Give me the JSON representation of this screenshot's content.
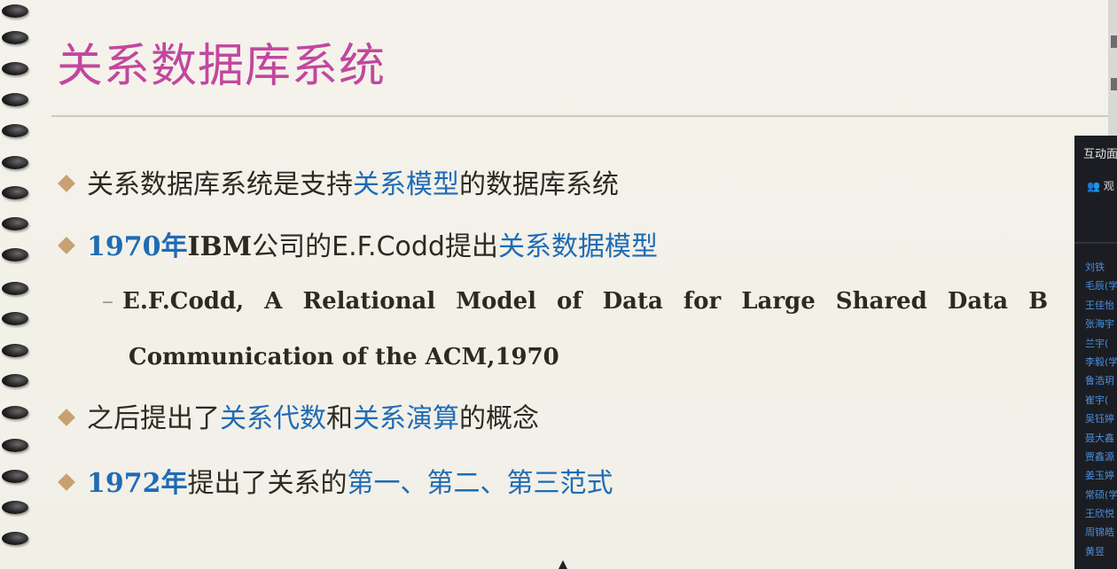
{
  "slide": {
    "title": "关系数据库系统",
    "bullets": [
      {
        "parts": [
          {
            "text": "关系数据库系统是支持",
            "style": "plain"
          },
          {
            "text": "关系模型",
            "style": "blue"
          },
          {
            "text": "的数据库系统",
            "style": "plain"
          }
        ]
      },
      {
        "parts": [
          {
            "text": "1970年",
            "style": "blue"
          },
          {
            "text": "IBM",
            "style": "plain"
          },
          {
            "text": "公司的E.F.Codd提出",
            "style": "plain"
          },
          {
            "text": "关系数据模型",
            "style": "blue"
          }
        ]
      },
      {
        "parts": [
          {
            "text": "之后提出了",
            "style": "plain"
          },
          {
            "text": "关系代数",
            "style": "blue"
          },
          {
            "text": "和",
            "style": "plain"
          },
          {
            "text": "关系演算",
            "style": "blue"
          },
          {
            "text": "的概念",
            "style": "plain"
          }
        ]
      },
      {
        "parts": [
          {
            "text": "1972年",
            "style": "blue"
          },
          {
            "text": "提出了关系的",
            "style": "plain"
          },
          {
            "text": "第一、第二、第三范式",
            "style": "blue"
          }
        ]
      }
    ],
    "sub_bullet": {
      "dash": "–",
      "line1": "E.F.Codd, A Relational Model of Data for Large Shared Data B",
      "line2": "Communication of the ACM,1970"
    }
  },
  "side_panel": {
    "title": "互动面",
    "user_label": "观",
    "names": [
      "刘铁",
      "毛辰(学",
      "王佳怡",
      "张海宇",
      "兰宇(",
      "李毅(学",
      "鲁浩玥",
      "崔宇(",
      "吴钰婷",
      "聂大鑫",
      "贾鑫源",
      "姜玉婷",
      "常硕(学",
      "王欣悦",
      "周锦皓",
      "黄昱"
    ]
  },
  "colors": {
    "title": "#c2479f",
    "text": "#2e2a22",
    "emphasis": "#1f6bb5",
    "bullet": "#c8a072"
  }
}
